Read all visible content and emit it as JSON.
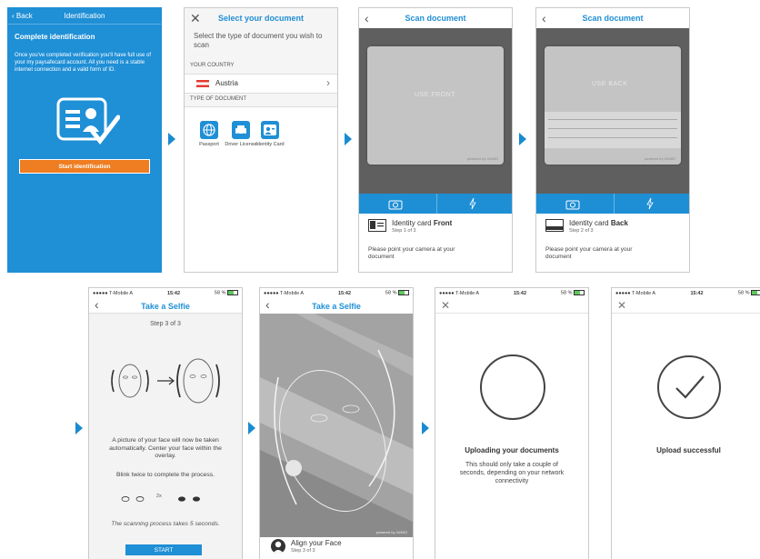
{
  "screen1": {
    "back_label": "Back",
    "title": "Identification",
    "heading": "Complete identification",
    "body": "Once you've completed verification you'll have full use of your my paysafecard account. All you need is a stable internet connection and a valid form of ID.",
    "button": "Start identification",
    "bg_color": "#1f8fd6"
  },
  "screen2": {
    "title": "Select your document",
    "prompt": "Select the type of document you wish to scan",
    "country_header": "YOUR COUNTRY",
    "country": "Austria",
    "doc_header": "TYPE OF DOCUMENT",
    "docs": [
      "Passport",
      "Driver License",
      "Identity Card"
    ]
  },
  "screen3": {
    "title": "Scan document",
    "card_text": "USE FRONT",
    "watermark": "powered by JUMIO",
    "doc_label": "Identity card",
    "doc_side": "Front",
    "step": "Step 1 of 3",
    "instruction": "Please point your camera at your document"
  },
  "screen4": {
    "title": "Scan document",
    "card_text": "USE BACK",
    "watermark": "powered by JUMIO",
    "doc_label": "Identity card",
    "doc_side": "Back",
    "step": "Step 2 of 3",
    "instruction": "Please point your camera at your document"
  },
  "screen5": {
    "carrier": "●●●●● T-Mobile A",
    "time": "15:42",
    "battery": "58 %",
    "title": "Take a Selfie",
    "step": "Step 3 of 3",
    "desc": "A picture of your face will now be taken automatically. Center your face within the overlay.",
    "blink": "Blink twice to complete the process.",
    "blink_count": "2x",
    "scan_note": "The scanning process takes 5 seconds.",
    "button": "START"
  },
  "screen6": {
    "carrier": "●●●●● T-Mobile A",
    "time": "15:42",
    "battery": "58 %",
    "title": "Take a Selfie",
    "align": "Align your Face",
    "step": "Step 3 of 3",
    "watermark": "powered by JUMIO"
  },
  "screen7": {
    "carrier": "●●●●● T-Mobile A",
    "time": "15:42",
    "battery": "58 %",
    "heading": "Uploading your documents",
    "desc": "This should only take a couple of seconds, depending on your network connectivity"
  },
  "screen8": {
    "carrier": "●●●●● T-Mobile A",
    "time": "15:42",
    "battery": "58 %",
    "heading": "Upload successful"
  }
}
